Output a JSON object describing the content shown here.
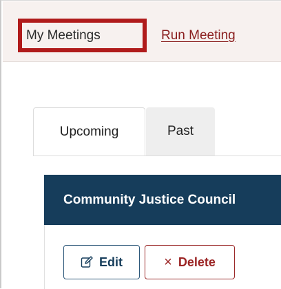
{
  "nav": {
    "my_meetings": "My Meetings",
    "run_meeting": "Run Meeting"
  },
  "tabs": [
    {
      "label": "Upcoming",
      "active": true
    },
    {
      "label": "Past",
      "active": false
    }
  ],
  "card": {
    "title": "Community Justice Council",
    "header_color": "#163d5b"
  },
  "actions": {
    "edit_label": "Edit",
    "edit_icon": "pencil-edit-icon",
    "delete_label": "Delete",
    "delete_icon": "close-x-icon",
    "delete_glyph": "×"
  },
  "colors": {
    "highlight_border": "#b01b1b",
    "link": "#8a1e1e",
    "delete": "#9b2424"
  }
}
